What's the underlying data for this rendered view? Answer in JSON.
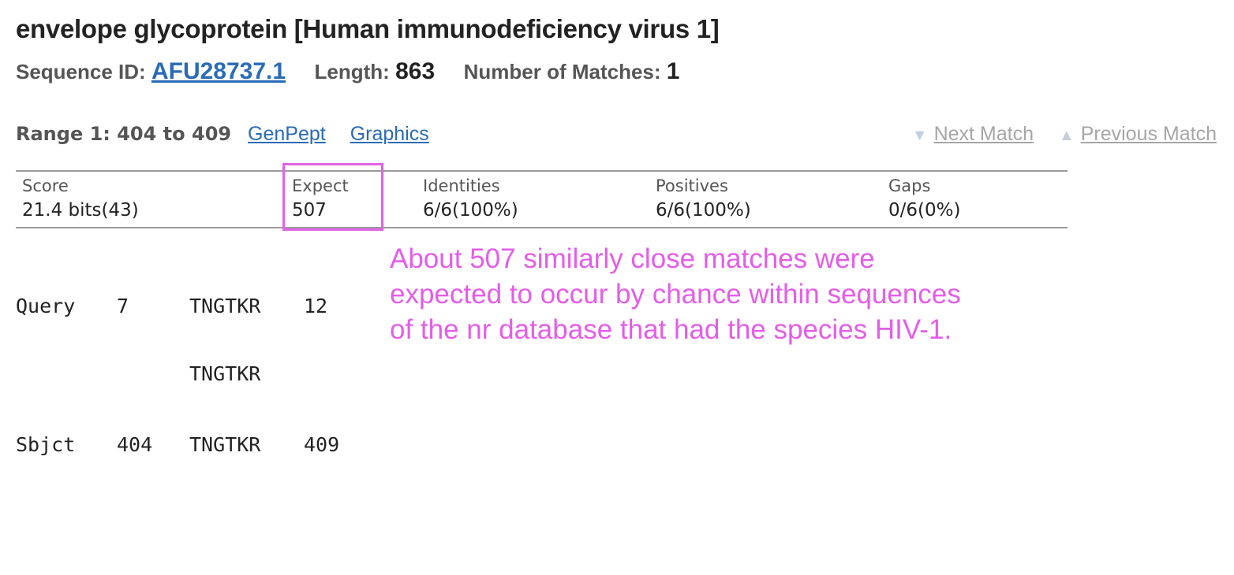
{
  "header": {
    "title": "envelope glycoprotein [Human immunodeficiency virus 1]",
    "sequence_id_label": "Sequence ID:",
    "sequence_id": "AFU28737.1",
    "length_label": "Length:",
    "length": "863",
    "matches_label": "Number of Matches:",
    "matches": "1"
  },
  "range": {
    "label": "Range 1: 404 to 409",
    "genpept_link": "GenPept",
    "graphics_link": "Graphics",
    "next_match": "Next Match",
    "previous_match": "Previous Match"
  },
  "stats": {
    "score_label": "Score",
    "score": "21.4 bits(43)",
    "expect_label": "Expect",
    "expect": "507",
    "identities_label": "Identities",
    "identities": "6/6(100%)",
    "positives_label": "Positives",
    "positives": "6/6(100%)",
    "gaps_label": "Gaps",
    "gaps": "0/6(0%)"
  },
  "alignment": {
    "query": {
      "label": "Query",
      "start": "7",
      "seq": "TNGTKR",
      "end": "12"
    },
    "midline": "TNGTKR",
    "sbjct": {
      "label": "Sbjct",
      "start": "404",
      "seq": "TNGTKR",
      "end": "409"
    }
  },
  "annotation": {
    "line1": "About 507 similarly close matches were",
    "line2": "expected to occur by chance within sequences",
    "line3": "of the nr database that had the species HIV-1."
  },
  "colors": {
    "link": "#2a6bb5",
    "highlight": "#e062e6",
    "annotation_text": "#e45de8",
    "disabled_nav": "#a6a6a6"
  }
}
